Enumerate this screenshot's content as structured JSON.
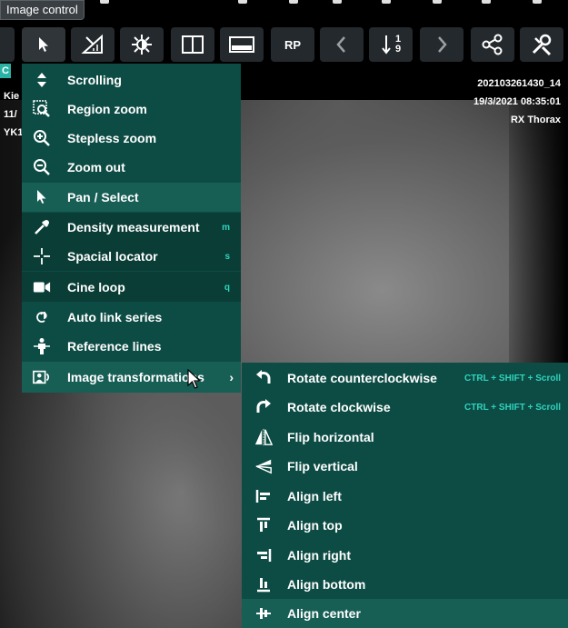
{
  "tooltip": {
    "text": "Image control"
  },
  "toolbar": {
    "buttons": [
      {
        "name": "pointer-icon",
        "label": ""
      },
      {
        "name": "measure-icon",
        "label": ""
      },
      {
        "name": "brightness-icon",
        "label": ""
      },
      {
        "name": "split-view-icon",
        "label": ""
      },
      {
        "name": "window-level-icon",
        "label": ""
      },
      {
        "name": "rp-button",
        "label": "RP"
      },
      {
        "name": "chevron-left-icon",
        "label": ""
      },
      {
        "name": "sort-icon",
        "label": ""
      },
      {
        "name": "chevron-right-icon",
        "label": ""
      },
      {
        "name": "share-icon",
        "label": ""
      },
      {
        "name": "tools-icon",
        "label": ""
      }
    ],
    "sort_top": "1",
    "sort_bottom": "9"
  },
  "overlay": {
    "left": [
      "Kie",
      "11/",
      "YK1"
    ],
    "right": [
      "202103261430_14",
      "19/3/2021 08:35:01",
      "RX Thorax"
    ],
    "badge": "C"
  },
  "main_menu": {
    "items": [
      {
        "label": "Scrolling",
        "icon": "scroll-icon",
        "key": ""
      },
      {
        "label": "Region zoom",
        "icon": "region-zoom-icon",
        "key": ""
      },
      {
        "label": "Stepless zoom",
        "icon": "zoom-in-icon",
        "key": ""
      },
      {
        "label": "Zoom out",
        "icon": "zoom-out-icon",
        "key": ""
      },
      {
        "label": "Pan / Select",
        "icon": "pointer-icon",
        "key": ""
      },
      {
        "label": "Density measurement",
        "icon": "dropper-icon",
        "key": "m"
      },
      {
        "label": "Spacial locator",
        "icon": "crosshair-icon",
        "key": "s"
      },
      {
        "label": "Cine loop",
        "icon": "video-icon",
        "key": "q"
      },
      {
        "label": "Auto link series",
        "icon": "link-icon",
        "key": ""
      },
      {
        "label": "Reference lines",
        "icon": "reference-icon",
        "key": ""
      },
      {
        "label": "Image transformations",
        "icon": "image-transform-icon",
        "key": ""
      }
    ]
  },
  "sub_menu": {
    "items": [
      {
        "label": "Rotate counterclockwise",
        "icon": "rotate-ccw-icon",
        "key": "CTRL + SHIFT + Scroll"
      },
      {
        "label": "Rotate clockwise",
        "icon": "rotate-cw-icon",
        "key": "CTRL + SHIFT + Scroll"
      },
      {
        "label": "Flip horizontal",
        "icon": "flip-horizontal-icon",
        "key": ""
      },
      {
        "label": "Flip vertical",
        "icon": "flip-vertical-icon",
        "key": ""
      },
      {
        "label": "Align left",
        "icon": "align-left-icon",
        "key": ""
      },
      {
        "label": "Align top",
        "icon": "align-top-icon",
        "key": ""
      },
      {
        "label": "Align right",
        "icon": "align-right-icon",
        "key": ""
      },
      {
        "label": "Align bottom",
        "icon": "align-bottom-icon",
        "key": ""
      },
      {
        "label": "Align center",
        "icon": "align-center-icon",
        "key": ""
      }
    ]
  },
  "colors": {
    "menu_bg": "#0d4c44",
    "menu_highlight": "#175e55",
    "shortcut": "#2fd3bd",
    "toolbar_button": "#24292d"
  }
}
